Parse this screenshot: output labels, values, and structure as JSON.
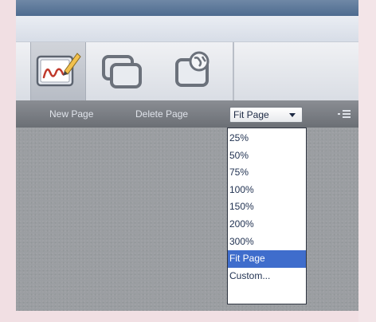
{
  "toolbar": {
    "tools": [
      {
        "icon": "pen-and-canvas-icon",
        "active": true
      },
      {
        "icon": "layered-windows-icon",
        "active": false
      },
      {
        "icon": "globe-window-icon",
        "active": false
      }
    ]
  },
  "action_bar": {
    "new_page_label": "New Page",
    "delete_page_label": "Delete Page",
    "zoom_selected": "Fit Page",
    "menu_icon": "list-menu-icon"
  },
  "zoom_dropdown": {
    "options": [
      "25%",
      "50%",
      "75%",
      "100%",
      "150%",
      "200%",
      "300%",
      "Fit Page",
      "Custom..."
    ],
    "selected_index": 7
  },
  "colors": {
    "selected_option": "#3f6dcc",
    "action_bar": "#7b7f85",
    "canvas": "#9b9ea2",
    "top_bar": "#5a7699"
  }
}
